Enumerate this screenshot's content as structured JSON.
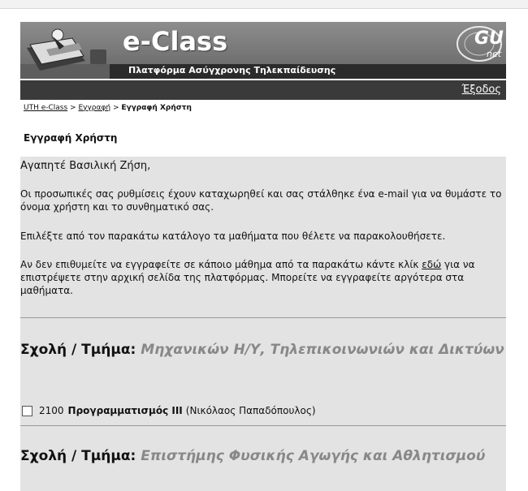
{
  "header": {
    "brand": "e-Class",
    "tagline": "Πλατφόρμα Ασύγχρονης Τηλεκπαίδευσης",
    "partner_logo": "GU",
    "partner_logo_sub": "net"
  },
  "nav": {
    "logout_label": "Έξοδος"
  },
  "breadcrumb": {
    "home": "UTH e-Class",
    "sep1": " > ",
    "registration": "Εγγραφή",
    "sep2": " > ",
    "current": "Εγγραφή Χρήστη"
  },
  "page_title": "Εγγραφή Χρήστη",
  "message": {
    "greeting": "Αγαπητέ Βασιλική Ζήση,",
    "p1": "Οι προσωπικές σας ρυθμίσεις έχουν καταχωρηθεί και σας στάλθηκε ένα e-mail για να θυμάστε το όνομα χρήστη και το συνθηματικό σας.",
    "p2": "Επιλέξτε από τον παρακάτω κατάλογο τα μαθήματα που θέλετε να παρακολουθήσετε.",
    "p3_before": "Αν δεν επιθυμείτε να εγγραφείτε σε κάποιο μάθημα από τα παρακάτω κάντε κλίκ ",
    "p3_link": "εδώ",
    "p3_after": " για να επιστρέψετε στην αρχική σελίδα της πλατφόρμας. Μπορείτε να εγγραφείτε αργότερα στα μαθήματα."
  },
  "departments": [
    {
      "label": "Σχολή / Τμήμα: ",
      "name": "Μηχανικών Η/Υ, Τηλεπικοινωνιών και Δικτύων",
      "courses": [
        {
          "code": "2100",
          "title": "Προγραμματισμός ΙΙΙ",
          "instructor": "(Νικόλαος Παπαδόπουλος)",
          "checked": false
        }
      ]
    },
    {
      "label": "Σχολή / Τμήμα: ",
      "name": "Επιστήμης Φυσικής Αγωγής και Αθλητισμού",
      "courses": []
    }
  ]
}
